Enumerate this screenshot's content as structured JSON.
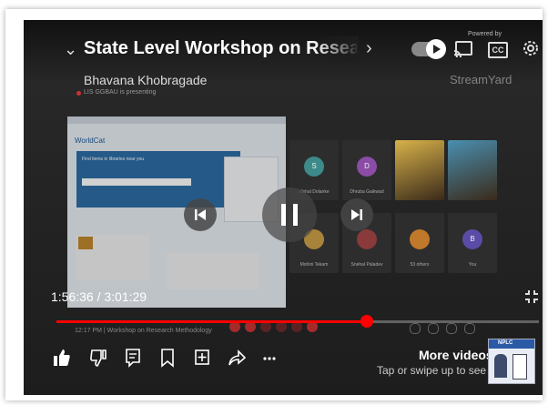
{
  "video": {
    "title": "State Level Workshop on Research Me",
    "presenter": "Bhavana Khobragade",
    "presenting_status": "LIS GGBAU is presenting",
    "time_display": "1:56:36 / 3:01:29",
    "progress_fraction": 0.6427,
    "powered_by": "Powered by",
    "watermark": "StreamYard",
    "autoplay_on": true
  },
  "shared_screen": {
    "logo": "WorldCat",
    "hero_title": "Find items in libraries near you"
  },
  "participants": [
    {
      "name": "Vishal Dolanke",
      "initial": "S",
      "color": "#3d8a8a"
    },
    {
      "name": "Dhruba Gaikwad",
      "initial": "D",
      "color": "#8a4ca6"
    },
    {
      "name": "",
      "initial": "",
      "color": "#d8b24a",
      "photo": true
    },
    {
      "name": "",
      "initial": "",
      "color": "#4a8fb0",
      "photo": true
    },
    {
      "name": "Mohini Tekam",
      "initial": "",
      "color": "#a8843a"
    },
    {
      "name": "Snehal Paladev",
      "initial": "",
      "color": "#8a3a3a"
    },
    {
      "name": "53 others",
      "initial": "",
      "color": "#c0782a"
    },
    {
      "name": "You",
      "initial": "B",
      "color": "#5a4ca6"
    }
  ],
  "bottom_bar": {
    "meeting_label": "12:17 PM | Workshop on Research Methodology"
  },
  "more_videos": {
    "title": "More videos",
    "subtitle": "Tap or swipe up to see all",
    "thumb_label": "NPLC"
  },
  "colors": {
    "progress": "#ff0000",
    "background": "#1b1b1b"
  },
  "icons": {
    "like": "thumbs-up-icon",
    "dislike": "thumbs-down-icon",
    "comments": "comment-icon",
    "save": "bookmark-icon",
    "add": "add-to-playlist-icon",
    "share": "share-icon",
    "more": "more-icon"
  }
}
